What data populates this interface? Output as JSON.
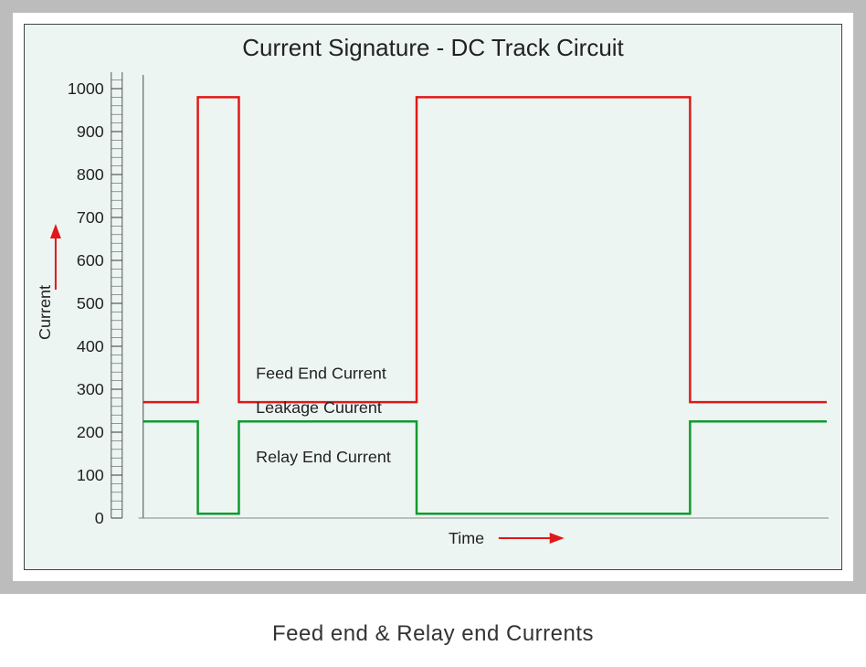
{
  "chart_data": {
    "type": "line",
    "title": "Current Signature - DC Track Circuit",
    "xlabel": "Time",
    "ylabel": "Current",
    "ylim": [
      0,
      1000
    ],
    "yticks": [
      0,
      100,
      200,
      300,
      400,
      500,
      600,
      700,
      800,
      900,
      1000
    ],
    "series": [
      {
        "name": "Feed End Current",
        "color": "#e01818",
        "x": [
          0,
          8,
          8,
          14,
          14,
          40,
          40,
          80,
          80,
          100
        ],
        "values": [
          270,
          270,
          980,
          980,
          270,
          270,
          980,
          980,
          270,
          270
        ]
      },
      {
        "name": "Relay End Current",
        "color": "#0d9a2e",
        "x": [
          0,
          8,
          8,
          14,
          14,
          40,
          40,
          80,
          80,
          100
        ],
        "values": [
          225,
          225,
          10,
          10,
          225,
          225,
          10,
          10,
          225,
          225
        ]
      }
    ],
    "annotations": [
      {
        "label": "Feed End Current",
        "x_frac": 0.3,
        "y_val": 335
      },
      {
        "label": "Leakage Cuurent",
        "x_frac": 0.3,
        "y_val": 255
      },
      {
        "label": "Relay End Current",
        "x_frac": 0.3,
        "y_val": 140
      }
    ]
  },
  "caption": "Feed end & Relay end Currents"
}
